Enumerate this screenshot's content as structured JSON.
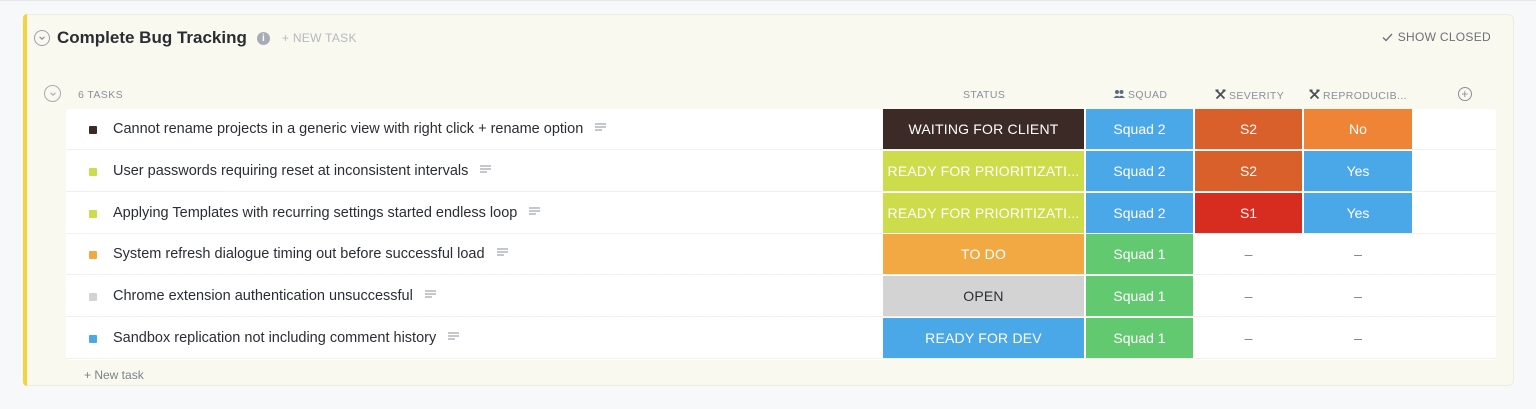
{
  "list": {
    "title": "Complete Bug Tracking",
    "info_icon": "info-icon",
    "new_task_top": "+ NEW TASK",
    "show_closed": "SHOW CLOSED",
    "task_count": "6 TASKS",
    "new_task_bottom": "+ New task",
    "accent_color": "#f5d33c"
  },
  "columns": {
    "status": "STATUS",
    "squad": "SQUAD",
    "severity": "SEVERITY",
    "reproducible": "REPRODUCIB..."
  },
  "rows": [
    {
      "name": "Cannot rename projects in a generic view with right click + rename option",
      "dot_color": "#3b2a25",
      "status": "WAITING FOR CLIENT",
      "status_color": "#3b2a25",
      "status_text_color": "#ffffff",
      "squad": "Squad 2",
      "squad_color": "#4aa8e8",
      "severity": "S2",
      "severity_color": "#d9602b",
      "reproducible": "No",
      "reproducible_color": "#f08436"
    },
    {
      "name": "User passwords requiring reset at inconsistent intervals",
      "dot_color": "#cddc4b",
      "status": "READY FOR PRIORITIZATI...",
      "status_color": "#cddc4b",
      "status_text_color": "#ffffff",
      "squad": "Squad 2",
      "squad_color": "#4aa8e8",
      "severity": "S2",
      "severity_color": "#d9602b",
      "reproducible": "Yes",
      "reproducible_color": "#4aa8e8"
    },
    {
      "name": "Applying Templates with recurring settings started endless loop",
      "dot_color": "#cddc4b",
      "status": "READY FOR PRIORITIZATI...",
      "status_color": "#cddc4b",
      "status_text_color": "#ffffff",
      "squad": "Squad 2",
      "squad_color": "#4aa8e8",
      "severity": "S1",
      "severity_color": "#d62d20",
      "reproducible": "Yes",
      "reproducible_color": "#4aa8e8"
    },
    {
      "name": "System refresh dialogue timing out before successful load",
      "dot_color": "#f2a843",
      "status": "TO DO",
      "status_color": "#f2a843",
      "status_text_color": "#ffffff",
      "squad": "Squad 1",
      "squad_color": "#63c971",
      "severity": "–",
      "severity_color": "",
      "reproducible": "–",
      "reproducible_color": ""
    },
    {
      "name": "Chrome extension authentication unsuccessful",
      "dot_color": "#d3d3d3",
      "status": "OPEN",
      "status_color": "#d3d3d3",
      "status_text_color": "#2a2e34",
      "squad": "Squad 1",
      "squad_color": "#63c971",
      "severity": "–",
      "severity_color": "",
      "reproducible": "–",
      "reproducible_color": ""
    },
    {
      "name": "Sandbox replication not including comment history",
      "dot_color": "#4aa8e8",
      "status": "READY FOR DEV",
      "status_color": "#4aa8e8",
      "status_text_color": "#ffffff",
      "squad": "Squad 1",
      "squad_color": "#63c971",
      "severity": "–",
      "severity_color": "",
      "reproducible": "–",
      "reproducible_color": ""
    }
  ]
}
